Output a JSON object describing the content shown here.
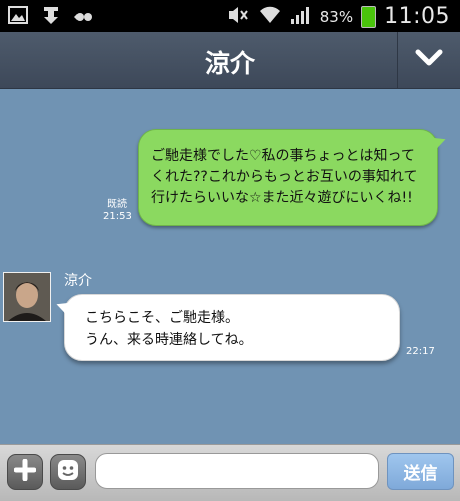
{
  "status_bar": {
    "battery": "83%",
    "time": "11:05"
  },
  "header": {
    "title": "涼介"
  },
  "messages": {
    "sent": {
      "lines": [
        "ご馳走様でした♡私の事ちょっとは知って",
        "くれた??これからもっとお互いの事知れて",
        "行けたらいいな☆また近々遊びにいくね!!"
      ],
      "read_label": "既読",
      "time": "21:53"
    },
    "received": {
      "sender": "涼介",
      "lines": [
        "こちらこそ、ご馳走様。",
        "うん、来る時連絡してね。"
      ],
      "time": "22:17"
    }
  },
  "input_bar": {
    "input_value": "",
    "send_label": "送信"
  },
  "colors": {
    "chat_bg": "#7093b3",
    "sent_bubble": "#8bd960",
    "received_bubble": "#ffffff"
  }
}
